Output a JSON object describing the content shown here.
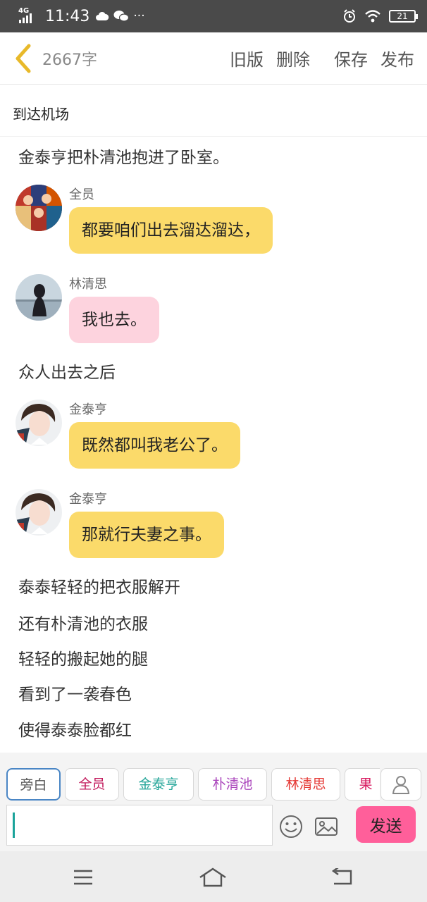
{
  "status_bar": {
    "network": "4G",
    "time": "11:43",
    "battery": "21",
    "icons": [
      "signal-icon",
      "cloud-icon",
      "wechat-icon",
      "more-icon",
      "alarm-icon",
      "wifi-icon",
      "battery-icon"
    ]
  },
  "toolbar": {
    "word_count": "2667字",
    "old_version": "旧版",
    "delete": "删除",
    "save": "保存",
    "publish": "发布",
    "accent": "#e8b92a"
  },
  "chapter": {
    "title": "到达机场"
  },
  "content": [
    {
      "type": "narration",
      "text": "金泰亨把朴清池抱进了卧室。"
    },
    {
      "type": "message",
      "sender": "全员",
      "text": "都要咱们出去溜达溜达，",
      "bubble_color": "#fbda6a",
      "avatar": "group-avatar"
    },
    {
      "type": "message",
      "sender": "林清思",
      "text": "我也去。",
      "bubble_color": "#fdd3de",
      "avatar": "girl-avatar"
    },
    {
      "type": "narration",
      "text": "众人出去之后"
    },
    {
      "type": "message",
      "sender": "金泰亨",
      "text": "既然都叫我老公了。",
      "bubble_color": "#fbda6a",
      "avatar": "boy-avatar"
    },
    {
      "type": "message",
      "sender": "金泰亨",
      "text": "那就行夫妻之事。",
      "bubble_color": "#fbda6a",
      "avatar": "boy-avatar"
    },
    {
      "type": "narration",
      "text": "泰泰轻轻的把衣服解开"
    },
    {
      "type": "narration",
      "text": "还有朴清池的衣服"
    },
    {
      "type": "narration",
      "text": "轻轻的搬起她的腿"
    },
    {
      "type": "narration",
      "text": "看到了一袭春色"
    },
    {
      "type": "narration",
      "text": "使得泰泰脸都红"
    }
  ],
  "roles": [
    {
      "label": "旁白",
      "color": "#555555",
      "active": true
    },
    {
      "label": "全员",
      "color": "#c2185b"
    },
    {
      "label": "金泰亨",
      "color": "#26a69a"
    },
    {
      "label": "朴清池",
      "color": "#ab47bc"
    },
    {
      "label": "林清思",
      "color": "#e53935"
    },
    {
      "label": "果",
      "color": "#d81b60"
    }
  ],
  "composer": {
    "input_value": "",
    "send": "发送",
    "send_color": "#ff5f9a"
  }
}
